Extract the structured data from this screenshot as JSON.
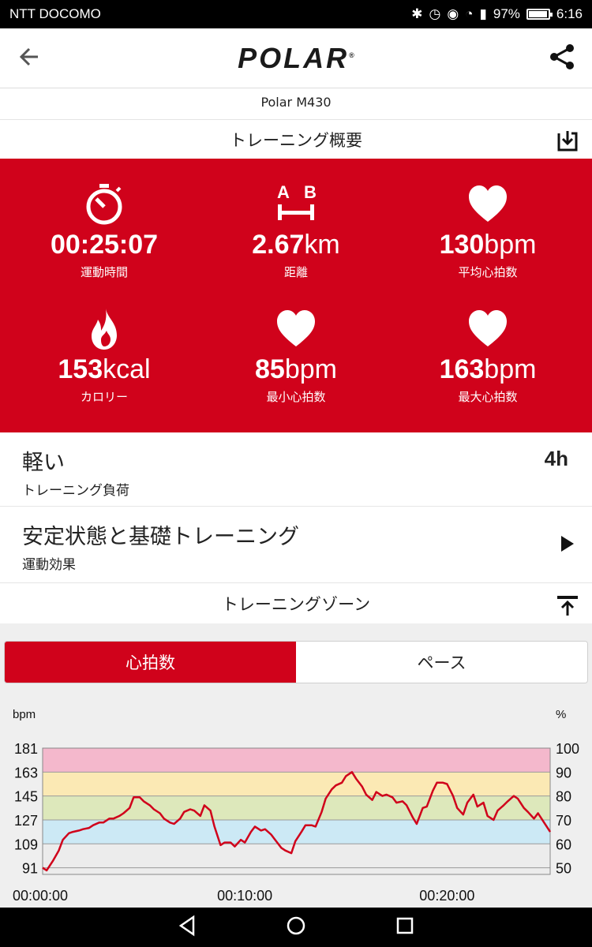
{
  "status": {
    "carrier": "NTT DOCOMO",
    "battery": "97%",
    "battery_level": 0.97,
    "time": "6:16"
  },
  "app": {
    "brand": "POLAR",
    "brand_mark": "®"
  },
  "device": "Polar M430",
  "summary": {
    "title": "トレーニング概要",
    "stats": [
      {
        "value": "00:25:07",
        "unit": "",
        "label": "運動時間",
        "icon": "stopwatch-icon"
      },
      {
        "value": "2.67",
        "unit": "km",
        "label": "距離",
        "icon": "distance-icon",
        "icon_text_a": "A",
        "icon_text_b": "B"
      },
      {
        "value": "130",
        "unit": "bpm",
        "label": "平均心拍数",
        "icon": "heart-icon"
      },
      {
        "value": "153",
        "unit": "kcal",
        "label": "カロリー",
        "icon": "flame-icon"
      },
      {
        "value": "85",
        "unit": "bpm",
        "label": "最小心拍数",
        "icon": "heart-icon"
      },
      {
        "value": "163",
        "unit": "bpm",
        "label": "最大心拍数",
        "icon": "heart-icon"
      }
    ]
  },
  "load": {
    "value": "軽い",
    "label": "トレーニング負荷",
    "recovery": "4h"
  },
  "benefit": {
    "value": "安定状態と基礎トレーニング",
    "label": "運動効果"
  },
  "zones": {
    "title": "トレーニングゾーン",
    "tabs": [
      "心拍数",
      "ペース"
    ],
    "active_tab": 0
  },
  "chart_data": {
    "type": "line",
    "ylabel_left": "bpm",
    "ylabel_right": "%",
    "yticks_left": [
      181,
      163,
      145,
      127,
      109,
      91
    ],
    "yticks_right": [
      100,
      90,
      80,
      70,
      60,
      50
    ],
    "xticks": [
      "00:00:00",
      "00:10:00",
      "00:20:00"
    ],
    "ylim": [
      86,
      181
    ],
    "xlim_minutes": [
      0,
      25.1
    ],
    "zones": [
      {
        "from": 163,
        "to": 181,
        "color": "#f4b8cc"
      },
      {
        "from": 145,
        "to": 163,
        "color": "#fbe9b4"
      },
      {
        "from": 127,
        "to": 145,
        "color": "#dde8bb"
      },
      {
        "from": 109,
        "to": 127,
        "color": "#cce9f5"
      },
      {
        "from": 86,
        "to": 109,
        "color": "#ececec"
      }
    ],
    "line_color": "#d0021b",
    "series": [
      {
        "x": [
          0.0,
          0.2,
          0.5,
          0.8,
          1.0,
          1.3,
          1.5,
          1.8,
          2.0,
          2.3,
          2.5,
          2.8,
          3.0,
          3.3,
          3.5,
          3.8,
          4.0,
          4.3,
          4.5,
          4.8,
          5.0,
          5.3,
          5.5,
          5.8,
          6.0,
          6.3,
          6.5,
          6.8,
          7.0,
          7.3,
          7.5,
          7.8,
          8.0,
          8.3,
          8.5,
          8.8,
          9.0,
          9.3,
          9.5,
          9.8,
          10.0,
          10.3,
          10.5,
          10.8,
          11.0,
          11.3,
          11.5,
          11.8,
          12.0,
          12.3,
          12.5,
          12.8,
          13.0,
          13.3,
          13.5,
          13.8,
          14.0,
          14.3,
          14.5,
          14.8,
          15.0,
          15.3,
          15.5,
          15.8,
          16.0,
          16.3,
          16.5,
          16.8,
          17.0,
          17.3,
          17.5,
          17.8,
          18.0,
          18.3,
          18.5,
          18.8,
          19.0,
          19.3,
          19.5,
          19.8,
          20.0,
          20.3,
          20.5,
          20.8,
          21.0,
          21.3,
          21.5,
          21.8,
          22.0,
          22.3,
          22.5,
          22.8,
          23.0,
          23.3,
          23.5,
          23.8,
          24.0,
          24.3,
          24.5,
          24.8,
          25.1
        ],
        "y": [
          91,
          89,
          96,
          104,
          112,
          117,
          118,
          119,
          120,
          121,
          123,
          125,
          125,
          128,
          128,
          130,
          132,
          136,
          144,
          144,
          141,
          138,
          135,
          132,
          128,
          125,
          124,
          128,
          133,
          135,
          134,
          130,
          138,
          134,
          122,
          108,
          110,
          110,
          107,
          112,
          110,
          118,
          122,
          119,
          120,
          116,
          112,
          106,
          104,
          102,
          111,
          118,
          123,
          123,
          122,
          133,
          143,
          150,
          153,
          155,
          160,
          163,
          158,
          152,
          146,
          142,
          148,
          145,
          146,
          144,
          140,
          141,
          138,
          129,
          124,
          136,
          137,
          149,
          155,
          155,
          154,
          145,
          136,
          131,
          140,
          146,
          137,
          140,
          130,
          127,
          134,
          138,
          141,
          145,
          143,
          136,
          133,
          128,
          132,
          125,
          118
        ]
      }
    ]
  }
}
